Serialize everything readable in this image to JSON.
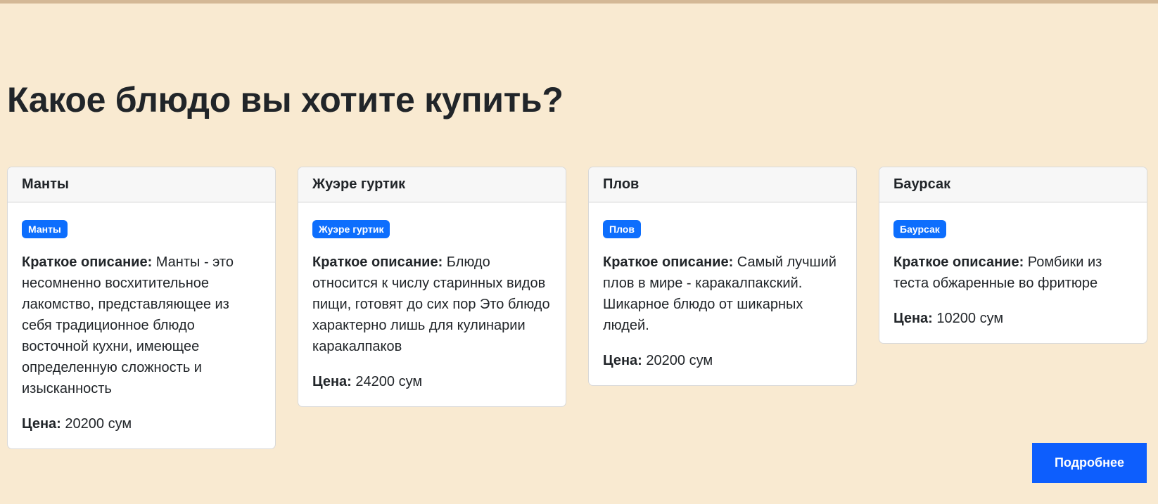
{
  "page": {
    "title": "Какое блюдо вы хотите купить?"
  },
  "labels": {
    "description": "Краткое описание:",
    "price": "Цена:"
  },
  "cards": [
    {
      "title": "Манты",
      "badge": "Манты",
      "description": "Манты - это несомненно восхитительное лакомство, представляющее из себя традиционное блюдо восточной кухни, имеющее определенную сложность и изысканность",
      "price": "20200 сум"
    },
    {
      "title": "Жуэре гуртик",
      "badge": "Жуэре гуртик",
      "description": "Блюдо относится к числу старинных видов пищи, готовят до сих пор Это блюдо характерно лишь для кулинарии каракалпаков",
      "price": "24200 сум"
    },
    {
      "title": "Плов",
      "badge": "Плов",
      "description": "Самый лучший плов в мире - каракалпакский. Шикарное блюдо от шикарных людей.",
      "price": "20200 сум"
    },
    {
      "title": "Баурсак",
      "badge": "Баурсак",
      "description": "Ромбики из теста обжаренные во фритюре",
      "price": "10200 сум"
    }
  ],
  "actions": {
    "more_label": "Подробнее"
  },
  "colors": {
    "background": "#f9ead1",
    "accent": "#0d6efd",
    "button": "#0d5efd"
  }
}
